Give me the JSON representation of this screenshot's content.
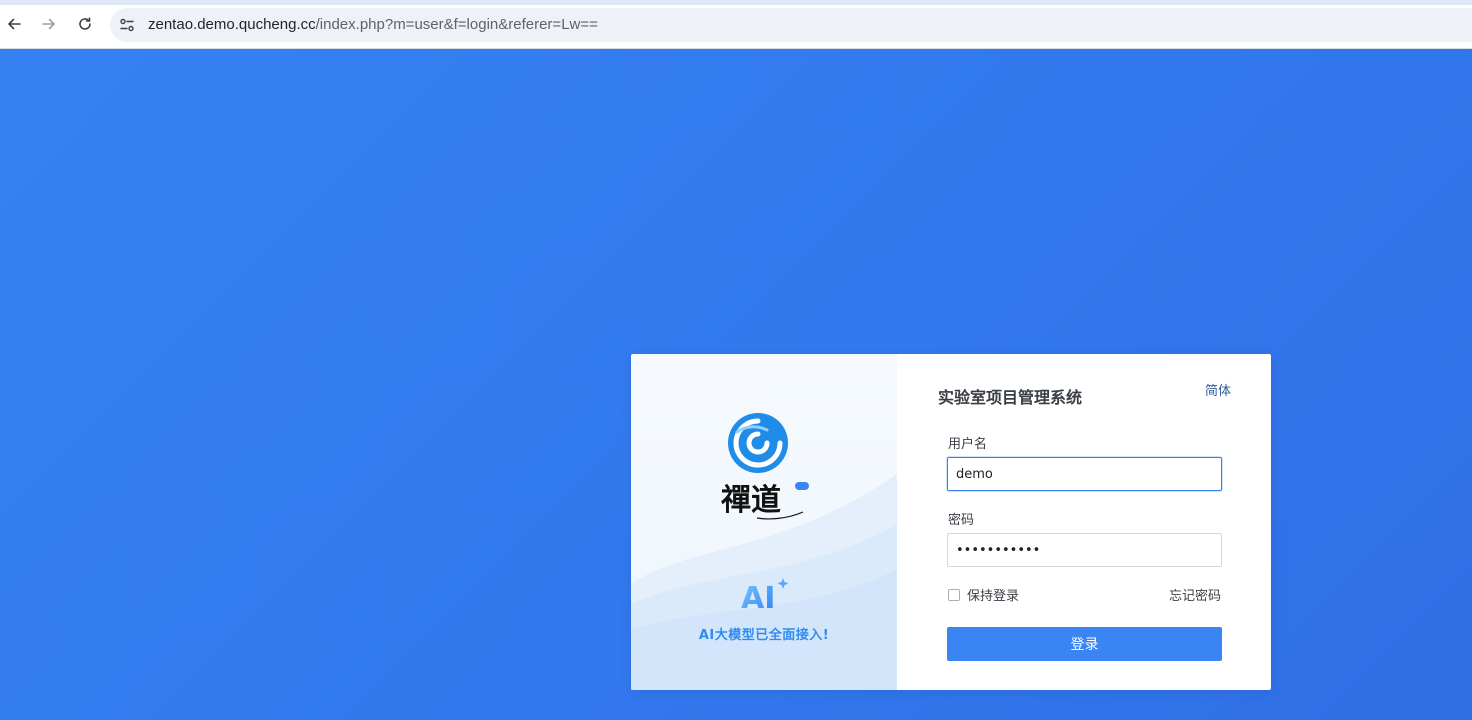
{
  "browser": {
    "url_host": "zentao.demo.qucheng.cc",
    "url_path": "/index.php?m=user&f=login&referer=Lw==",
    "icons": [
      "back-icon",
      "forward-icon",
      "reload-icon",
      "site-settings-icon"
    ]
  },
  "brand": {
    "name_glyphs": "禪道",
    "ai_badge": "AI",
    "ai_tagline": "AI大模型已全面接入!"
  },
  "login": {
    "title": "实验室项目管理系统",
    "language": "简体",
    "username_label": "用户名",
    "username_value": "demo",
    "password_label": "密码",
    "password_value": "demo1234567",
    "keep_login_label": "保持登录",
    "forgot_password": "忘记密码",
    "submit_label": "登录"
  },
  "colors": {
    "background": "#3278ee",
    "button": "#3a84f3",
    "brand_blue": "#2f8cf0"
  }
}
